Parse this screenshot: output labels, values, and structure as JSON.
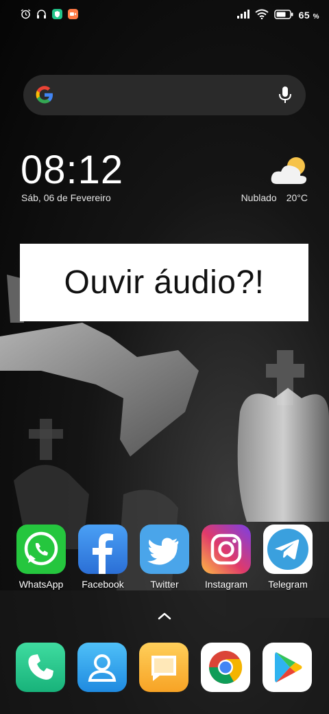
{
  "status_bar": {
    "left_icons": [
      "alarm-icon",
      "headphones-icon",
      "shield-app-icon",
      "video-app-icon"
    ],
    "right_icons": [
      "signal-icon",
      "wifi-icon",
      "battery-icon"
    ],
    "battery_percent": "65",
    "battery_unit": "%"
  },
  "search": {
    "icon": "google-g-icon",
    "voice_icon": "microphone-icon"
  },
  "clock": {
    "time": "08:12",
    "date": "Sáb, 06 de Fevereiro"
  },
  "weather": {
    "icon": "partly-cloudy-icon",
    "condition": "Nublado",
    "temperature": "20°C"
  },
  "banner": {
    "text": "Ouvir áudio?!"
  },
  "apps": [
    {
      "label": "WhatsApp",
      "icon": "whatsapp-icon",
      "color": "#25c63e"
    },
    {
      "label": "Facebook",
      "icon": "facebook-icon",
      "color": "#3b8be8"
    },
    {
      "label": "Twitter",
      "icon": "twitter-icon",
      "color": "#4aa5ea"
    },
    {
      "label": "Instagram",
      "icon": "instagram-icon",
      "color": "#d62976"
    },
    {
      "label": "Telegram",
      "icon": "telegram-icon",
      "color": "#3aa0de"
    }
  ],
  "dock": [
    {
      "icon": "phone-icon",
      "color": "#22c48a"
    },
    {
      "icon": "contacts-icon",
      "color": "#2fa3e8"
    },
    {
      "icon": "messages-icon",
      "color": "#f7b731"
    },
    {
      "icon": "chrome-icon",
      "color": "#ffffff"
    },
    {
      "icon": "play-store-icon",
      "color": "#ffffff"
    }
  ],
  "drawer_hint_icon": "chevron-up-icon"
}
